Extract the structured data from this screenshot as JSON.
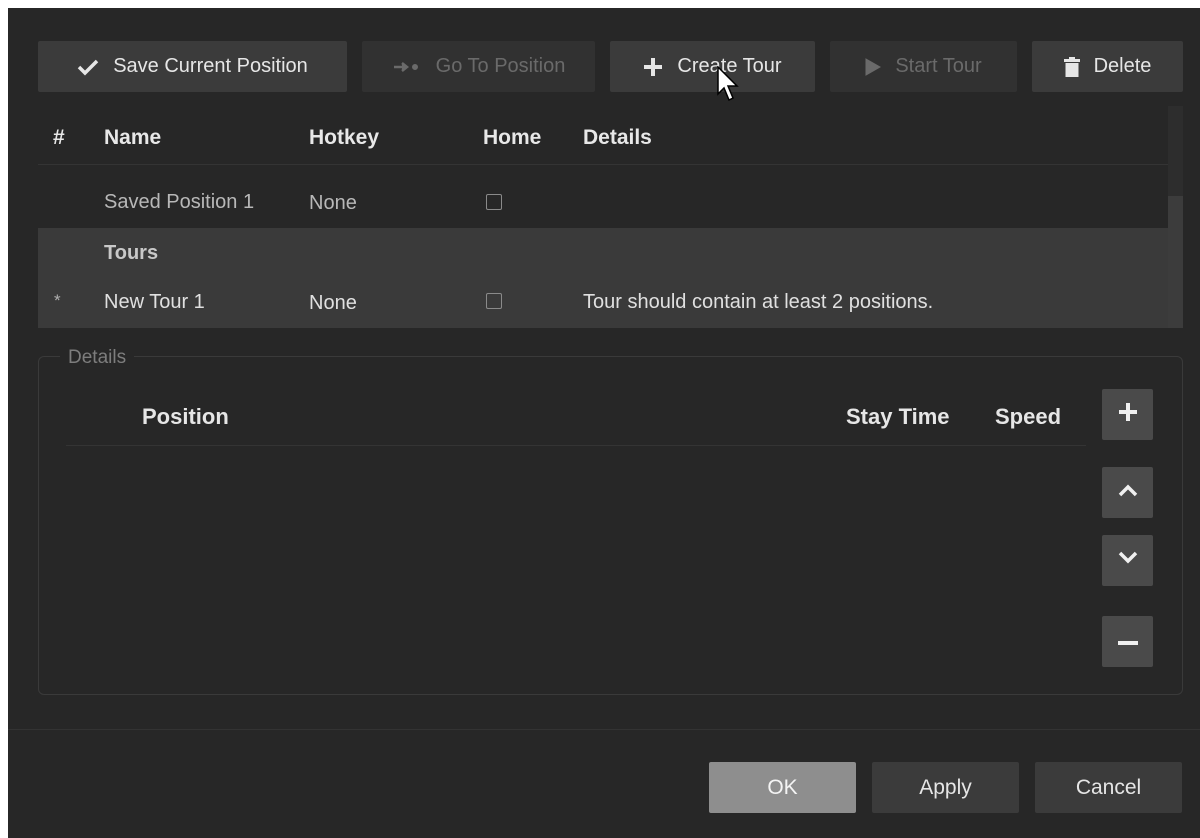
{
  "toolbar": {
    "save_position": "Save Current Position",
    "go_to_position": "Go To Position",
    "create_tour": "Create Tour",
    "start_tour": "Start Tour",
    "delete": "Delete"
  },
  "table": {
    "columns": [
      "#",
      "Name",
      "Hotkey",
      "Home",
      "Details"
    ],
    "rows": [
      {
        "marker": "",
        "name": "Saved Position 1",
        "hotkey": "None",
        "home": false,
        "details": ""
      },
      {
        "group": "Tours"
      },
      {
        "marker": "*",
        "name": "New Tour 1",
        "hotkey": "None",
        "home": false,
        "details": "Tour should contain at least 2 positions."
      }
    ]
  },
  "details": {
    "title": "Details",
    "columns": {
      "position": "Position",
      "stay_time": "Stay Time",
      "speed": "Speed"
    }
  },
  "footer": {
    "ok": "OK",
    "apply": "Apply",
    "cancel": "Cancel"
  },
  "icons": {
    "save": "checkmark-icon",
    "go_to": "arrow-right-icon",
    "create": "plus-icon",
    "start": "play-icon",
    "delete": "trash-icon"
  }
}
